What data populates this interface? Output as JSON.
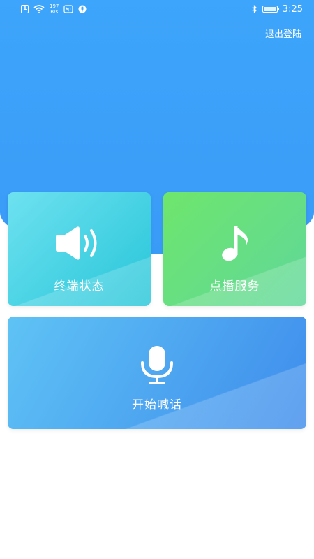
{
  "status_bar": {
    "sim_label": "1",
    "speed_value": "197",
    "speed_unit": "B/s",
    "time": "3:25"
  },
  "header": {
    "logout_label": "退出登陆"
  },
  "cards": {
    "terminal": {
      "label": "终端状态",
      "icon": "speaker-icon"
    },
    "vod": {
      "label": "点播服务",
      "icon": "music-note-icon"
    },
    "talk": {
      "label": "开始喊话",
      "icon": "microphone-icon"
    }
  },
  "colors": {
    "header_blue": "#3da5fb",
    "terminal_card": "#3fd0e2",
    "vod_card": "#66df80",
    "talk_card": "#4ea6f0"
  }
}
